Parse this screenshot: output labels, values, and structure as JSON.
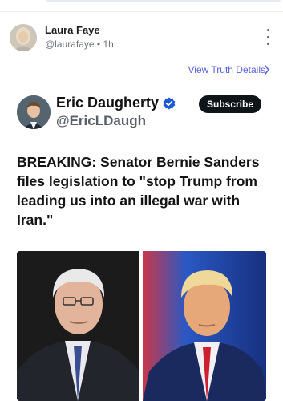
{
  "post": {
    "author_name": "Laura Faye",
    "author_handle": "@laurafaye",
    "separator": "•",
    "time_ago": "1h",
    "view_details_label": "View Truth Details"
  },
  "embedded_tweet": {
    "name": "Eric Daugherty",
    "handle": "@EricLDaugh",
    "subscribe_label": "Subscribe",
    "text": "BREAKING: Senator Bernie Sanders files legislation to \"stop Trump from leading us into an illegal war with Iran.\""
  },
  "colors": {
    "link": "#5a62d9",
    "verified_badge": "#1d5bd6",
    "subscribe_bg": "#0f1419"
  },
  "icons": [
    "more-vertical-icon",
    "chevron-right-icon",
    "verified-badge-icon"
  ]
}
